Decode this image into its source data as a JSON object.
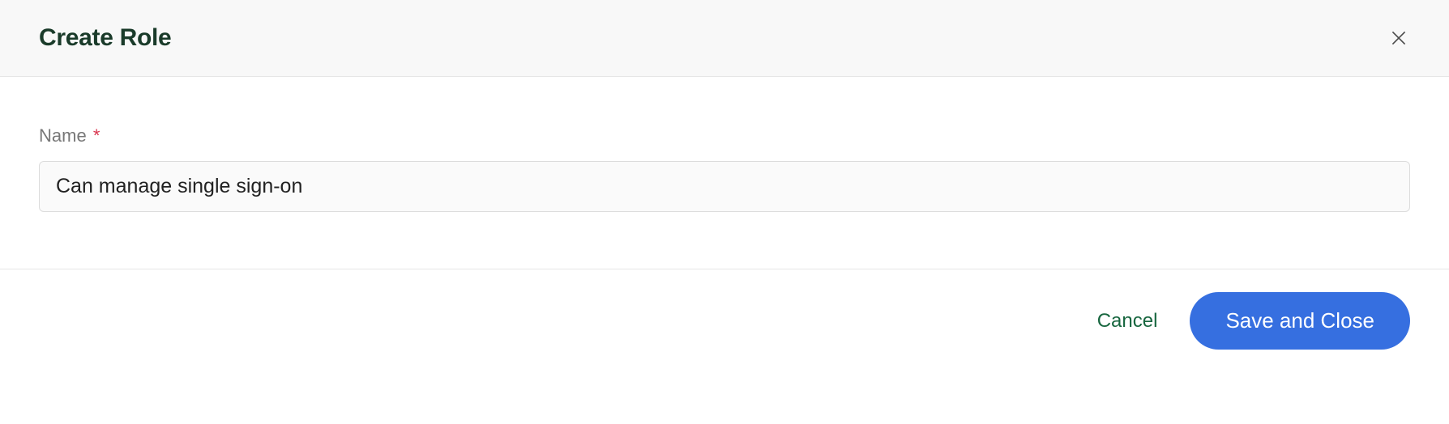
{
  "header": {
    "title": "Create Role"
  },
  "form": {
    "name_label": "Name",
    "required_mark": "*",
    "name_value": "Can manage single sign-on"
  },
  "footer": {
    "cancel_label": "Cancel",
    "save_label": "Save and Close"
  }
}
